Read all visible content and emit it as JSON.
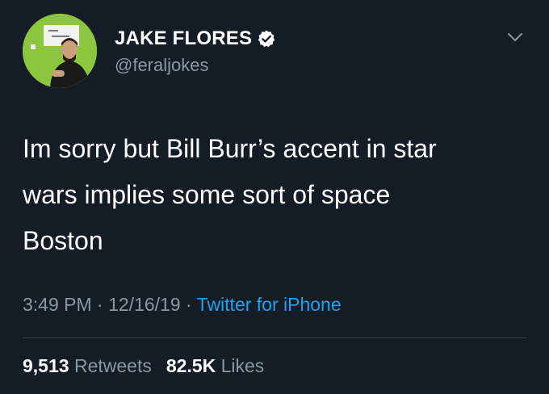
{
  "user": {
    "display_name": "JAKE FLORES",
    "handle": "@feraljokes",
    "verified": true
  },
  "tweet": {
    "lines": [
      "Im sorry but Bill Burr’s accent in star",
      "wars implies some sort of space",
      "Boston"
    ],
    "time": "3:49 PM",
    "separator": " · ",
    "date": "12/16/19",
    "source": "Twitter for iPhone"
  },
  "stats": {
    "retweets_count": "9,513",
    "retweets_label": "Retweets",
    "likes_count": "82.5K",
    "likes_label": "Likes"
  },
  "icons": {
    "verified": "verified-badge-icon",
    "menu": "chevron-down-icon"
  },
  "colors": {
    "background": "#141d26",
    "text_primary": "#ffffff",
    "text_secondary": "#8899a6",
    "link": "#1da1f2",
    "avatar_bg": "#8cc63f"
  }
}
